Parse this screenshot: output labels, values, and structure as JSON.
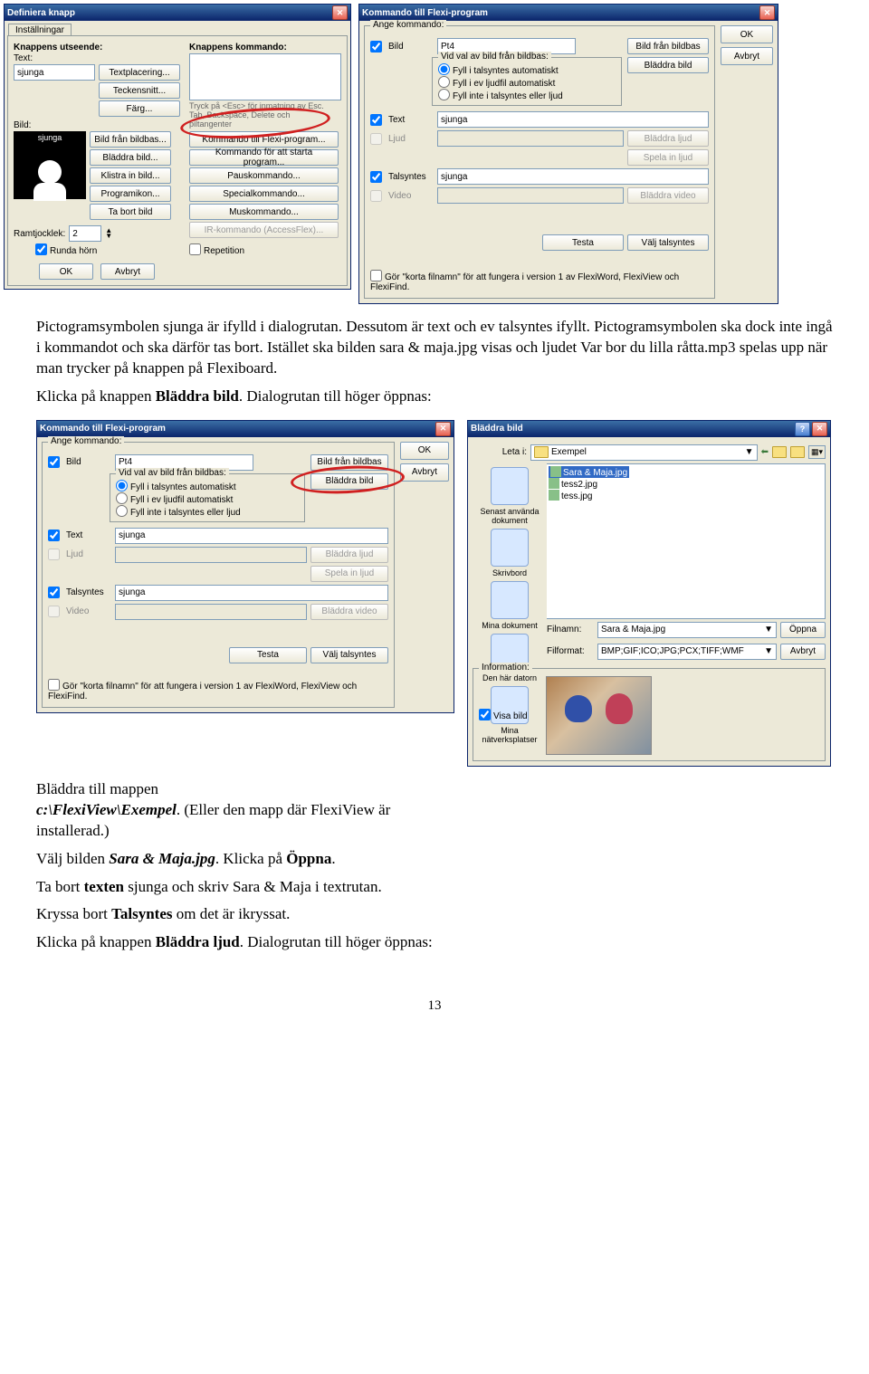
{
  "dlg1": {
    "title": "Definiera knapp",
    "tab": "Inställningar",
    "left_header": "Knappens utseende:",
    "right_header": "Knappens kommando:",
    "label_text": "Text:",
    "value_text": "sjunga",
    "btns_mid": [
      "Textplacering...",
      "Teckensnitt...",
      "Färg..."
    ],
    "label_bild": "Bild:",
    "picto_caption": "sjunga",
    "btns_right_of_pic": [
      "Bild från bildbas...",
      "Bläddra bild...",
      "Klistra in bild...",
      "Programikon...",
      "Ta bort bild"
    ],
    "cmd_note": "Tryck på <Esc> för inmatning av Esc. Tab, Backspace, Delete och piltangenter",
    "cmd_buttons": [
      "Kommando till Flexi-program...",
      "Kommando för att starta program...",
      "Pauskommando...",
      "Specialkommando...",
      "Muskommando...",
      "IR-kommando (AccessFlex)..."
    ],
    "repetition": "Repetition",
    "ramlabel": "Ramtjocklek:",
    "ramval": "2",
    "rund": "Runda hörn",
    "ok": "OK",
    "cancel": "Avbryt"
  },
  "dlg2": {
    "title": "Kommando till Flexi-program",
    "header": "Ange kommando:",
    "chk_bild": "Bild",
    "bild_val": "Pt4",
    "btn_bfb": "Bild från bildbas",
    "valgrp": "Vid val av bild från bildbas:",
    "opt1": "Fyll i talsyntes automatiskt",
    "opt2": "Fyll i ev ljudfil automatiskt",
    "opt3": "Fyll inte i talsyntes eller ljud",
    "btn_browse_bild": "Bläddra bild",
    "chk_text": "Text",
    "text_val": "sjunga",
    "chk_ljud": "Ljud",
    "btn_browse_ljud": "Bläddra ljud",
    "btn_spela": "Spela in ljud",
    "chk_tal": "Talsyntes",
    "tal_val": "sjunga",
    "chk_video": "Video",
    "btn_browse_video": "Bläddra video",
    "btn_testa": "Testa",
    "btn_valj_tal": "Välj talsyntes",
    "korta": "Gör \"korta filnamn\" för att fungera i version 1 av FlexiWord, FlexiView och FlexiFind.",
    "ok": "OK",
    "cancel": "Avbryt"
  },
  "para1": "Pictogramsymbolen sjunga är ifylld i dialogrutan. Dessutom är text och ev talsyntes ifyllt. Pictogramsymbolen ska dock inte ingå i kommandot och ska därför tas bort. Istället ska bilden sara & maja.jpg visas och ljudet Var bor du lilla råtta.mp3 spelas upp när man trycker på knappen på Flexiboard.",
  "para2_pre": "Klicka på knappen ",
  "para2_bold": "Bläddra bild",
  "para2_post": ". Dialogrutan till höger öppnas:",
  "dlg3": {
    "title": "Bläddra bild",
    "leta": "Leta i:",
    "folder": "Exempel",
    "files": [
      "Sara & Maja.jpg",
      "tess2.jpg",
      "tess.jpg"
    ],
    "side": [
      "Senast använda dokument",
      "Skrivbord",
      "Mina dokument",
      "Den här datorn",
      "Mina nätverksplatser"
    ],
    "fname_lbl": "Filnamn:",
    "fname": "Sara & Maja.jpg",
    "ftype_lbl": "Filformat:",
    "ftype": "BMP;GIF;ICO;JPG;PCX;TIFF;WMF",
    "open": "Öppna",
    "cancel": "Avbryt",
    "info_hdr": "Information:",
    "visa": "Visa bild"
  },
  "lower1": "Bläddra till mappen",
  "lower1b": "c:\\FlexiView\\Exempel",
  "lower1c": ". (Eller den mapp där FlexiView är installerad.)",
  "lower2a": "Välj bilden ",
  "lower2b": "Sara & Maja.jpg",
  "lower2c": ". Klicka på ",
  "lower2d": "Öppna",
  "lower3a": "Ta bort ",
  "lower3b": "texten",
  "lower3c": " sjunga och skriv Sara & Maja i textrutan.",
  "lower4a": "Kryssa bort ",
  "lower4b": "Talsyntes",
  "lower4c": " om det är ikryssat.",
  "lower5a": "Klicka på knappen ",
  "lower5b": "Bläddra ljud",
  "lower5c": ". Dialogrutan till höger öppnas:",
  "pagenum": "13"
}
